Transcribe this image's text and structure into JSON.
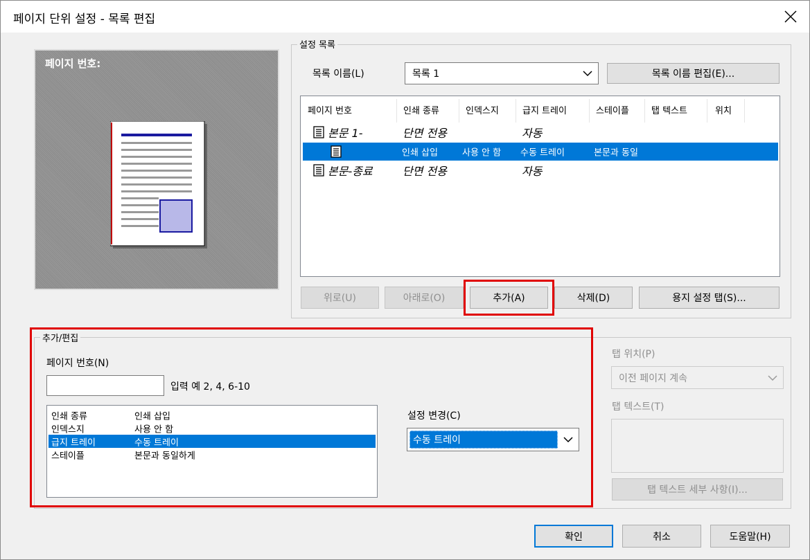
{
  "window": {
    "title": "페이지 단위 설정 - 목록 편집",
    "close_icon": "close-icon"
  },
  "preview": {
    "label": "페이지 번호:"
  },
  "settings_list": {
    "group_label": "설정 목록",
    "list_name_label": "목록 이름(L)",
    "list_name_value": "목록 1",
    "edit_name_button": "목록 이름 편집(E)...",
    "columns": [
      "페이지 번호",
      "인쇄 종류",
      "인덱스지",
      "급지 트레이",
      "스테이플",
      "탭 텍스트",
      "위치"
    ],
    "rows": [
      {
        "page": "본문 1-",
        "print_type": "단면 전용",
        "index": "",
        "tray": "자동",
        "staple": "",
        "selected": false,
        "italic": true
      },
      {
        "page": "",
        "print_type": "인쇄 삽입",
        "index": "사용 안 함",
        "tray": "수동 트레이",
        "staple": "본문과 동일",
        "selected": true,
        "italic": false
      },
      {
        "page": "본문-종료",
        "print_type": "단면 전용",
        "index": "",
        "tray": "자동",
        "staple": "",
        "selected": false,
        "italic": true
      }
    ],
    "buttons": {
      "up": "위로(U)",
      "down": "아래로(O)",
      "add": "추가(A)",
      "delete": "삭제(D)",
      "paper_tab": "용지 설정 탭(S)..."
    }
  },
  "add_edit": {
    "group_label": "추가/편집",
    "page_number_label": "페이지 번호(N)",
    "page_number_value": "",
    "input_example": "입력 예 2, 4, 6-10",
    "items": [
      {
        "name": "인쇄 종류",
        "value": "인쇄 삽입",
        "selected": false
      },
      {
        "name": "인덱스지",
        "value": "사용 안 함",
        "selected": false
      },
      {
        "name": "급지 트레이",
        "value": "수동 트레이",
        "selected": true
      },
      {
        "name": "스테이플",
        "value": "본문과 동일하게",
        "selected": false
      }
    ],
    "change_setting_label": "설정 변경(C)",
    "change_setting_value": "수동 트레이"
  },
  "tab_settings": {
    "tab_position_label": "탭 위치(P)",
    "tab_position_value": "이전 페이지 계속",
    "tab_text_label": "탭 텍스트(T)",
    "tab_text_detail_button": "탭 텍스트 세부 사항(I)..."
  },
  "footer": {
    "ok": "확인",
    "cancel": "취소",
    "help": "도움말(H)"
  },
  "colors": {
    "selection": "#0078d7",
    "highlight_box": "#e00000"
  }
}
